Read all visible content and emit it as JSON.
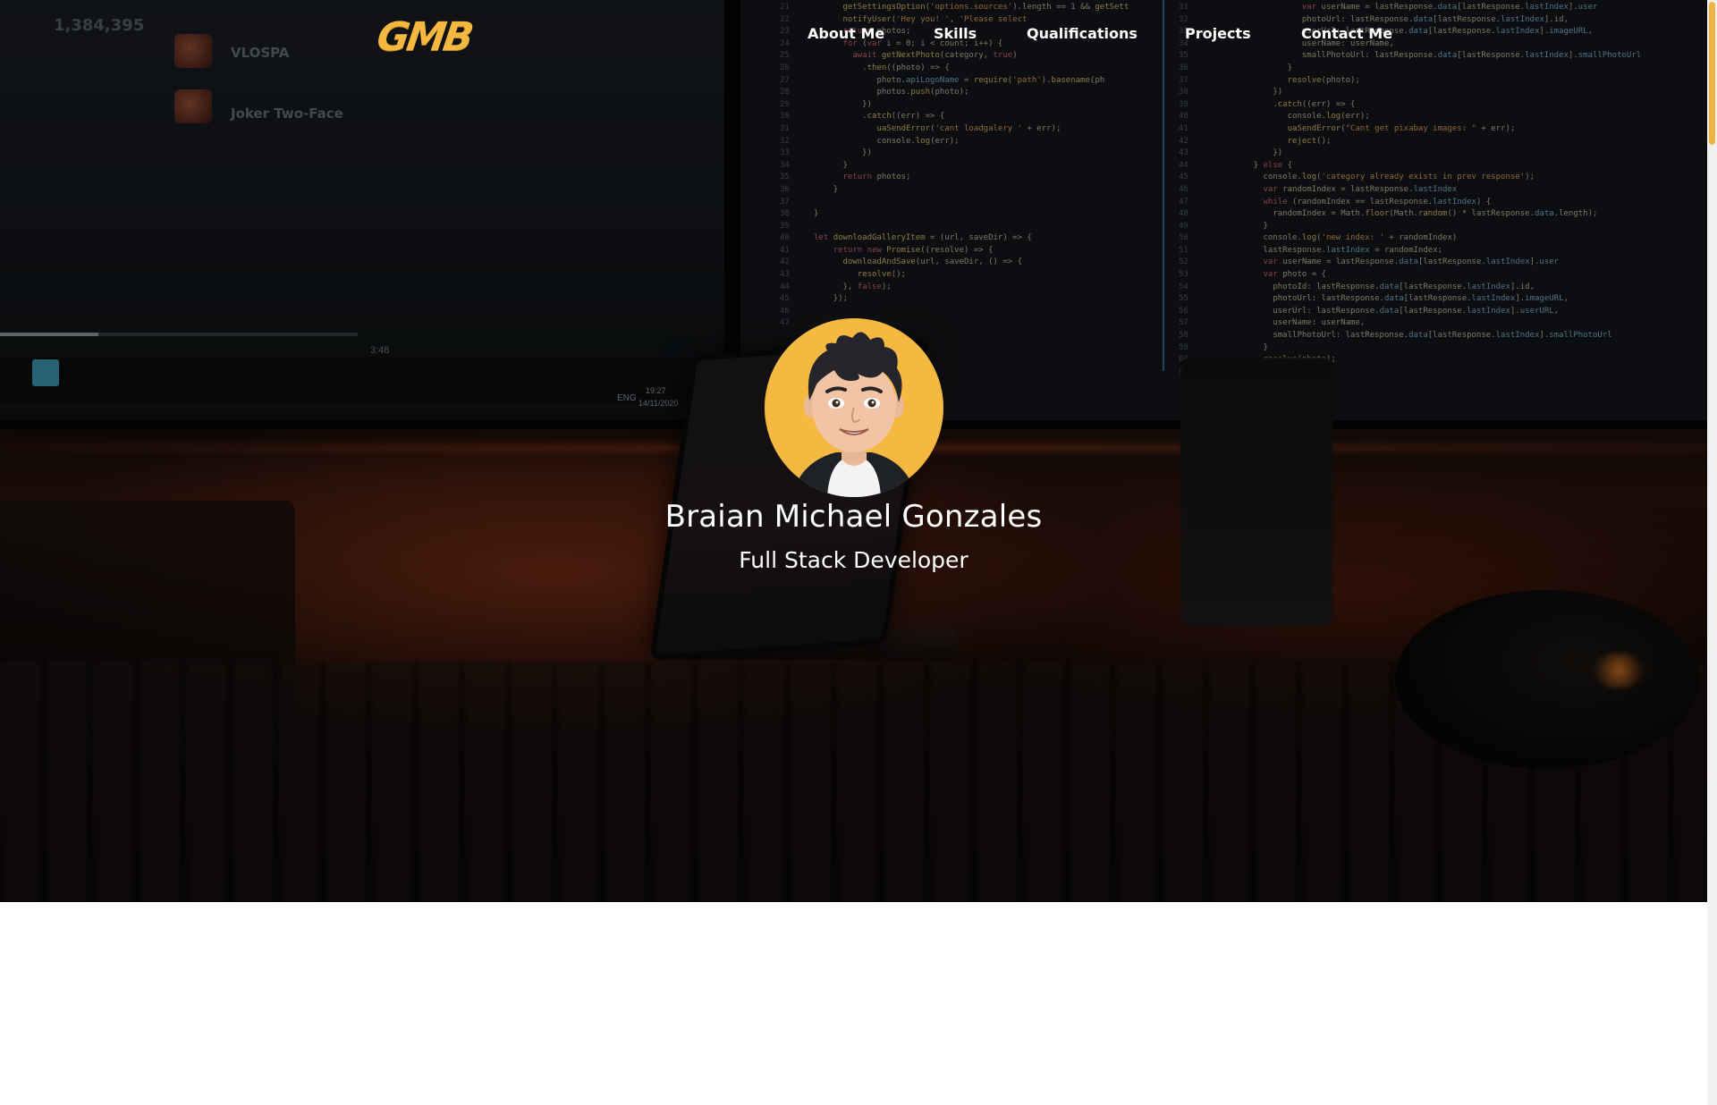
{
  "site": {
    "logo_text": "GMB",
    "brand_color": "#f4b740"
  },
  "nav": {
    "items": [
      {
        "label": "About Me"
      },
      {
        "label": "Skills"
      },
      {
        "label": "Qualifications"
      },
      {
        "label": "Projects"
      },
      {
        "label": "Contact Me"
      }
    ]
  },
  "profile": {
    "name": "Braian Michael Gonzales",
    "role": "Full Stack Developer",
    "avatar_icon": "cartoon-avatar",
    "avatar_bg": "#f5b942"
  },
  "background": {
    "left_screen": {
      "number": "1,384,395",
      "rows": [
        "VLOSPA",
        "Joker Two-Face"
      ],
      "time": "3:48",
      "tray_lang": "ENG",
      "tray_time": "19:27",
      "tray_date": "14/11/2020"
    }
  },
  "scrollbar": {
    "thumb_color": "#f0b342"
  }
}
